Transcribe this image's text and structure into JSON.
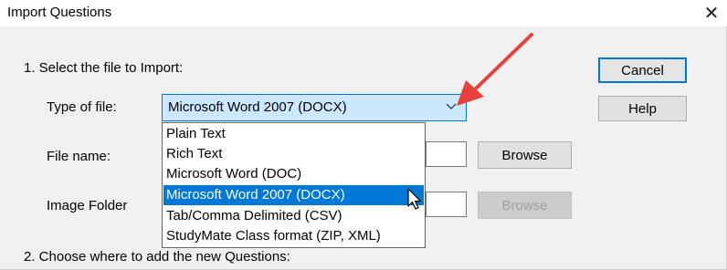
{
  "window": {
    "title": "Import Questions",
    "close_glyph": "✕"
  },
  "section1": {
    "heading": "1. Select the file to Import:"
  },
  "type_of_file": {
    "label": "Type of file:",
    "selected": "Microsoft Word 2007 (DOCX)",
    "options": [
      "Plain Text",
      "Rich Text",
      "Microsoft Word (DOC)",
      "Microsoft Word 2007 (DOCX)",
      "Tab/Comma Delimited (CSV)",
      "StudyMate Class format (ZIP, XML)"
    ]
  },
  "file_name": {
    "label": "File name:",
    "browse_label": "Browse"
  },
  "image_folder": {
    "label": "Image Folder",
    "browse_label": "Browse"
  },
  "buttons": {
    "cancel": "Cancel",
    "help": "Help"
  },
  "section2": {
    "heading": "2. Choose where to add the new Questions:"
  },
  "colors": {
    "accent": "#0078d7",
    "annotation_arrow": "#e8403a",
    "combo_highlight": "#cce8ff"
  },
  "icons": {
    "dropdown": "chevron-down-icon",
    "pointer": "mouse-pointer-icon",
    "annotation": "red-arrow-annotation"
  }
}
